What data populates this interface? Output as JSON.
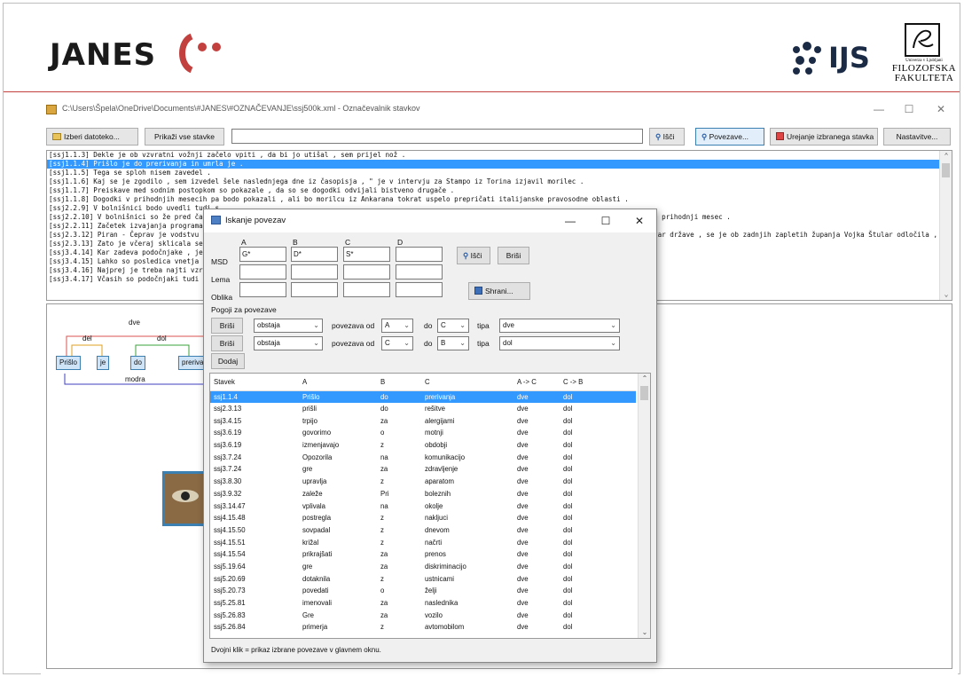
{
  "header": {
    "janes_label": "JANES",
    "ijs_label": "IJS",
    "ff_small": "Univerza v Ljubljani",
    "ff_line1": "FILOZOFSKA",
    "ff_line2": "FAKULTETA",
    "brand_color": "#c2413f"
  },
  "window": {
    "title": "C:\\Users\\Špela\\OneDrive\\Documents\\#JANES\\#OZNAČEVANJE\\ssj500k.xml - Označevalnik stavkov",
    "minimize": "—",
    "maximize": "☐",
    "close": "✕"
  },
  "toolbar": {
    "choose_file": "Izberi datoteko...",
    "show_all": "Prikaži vse stavke",
    "search_value": "",
    "search_btn": "Išči",
    "links_btn": "Povezave...",
    "edit_btn": "Urejanje izbranega stavka",
    "settings_btn": "Nastavitve..."
  },
  "sentences": [
    {
      "text": "[ssj1.1.3] Dekle je ob vzvratni vožnji začelo vpiti , da bi jo utišal , sem prijel nož .",
      "selected": false
    },
    {
      "text": "[ssj1.1.4] Prišlo je do prerivanja in umrla je .",
      "selected": true
    },
    {
      "text": "[ssj1.1.5] Tega se sploh nisem zavedel .",
      "selected": false
    },
    {
      "text": "[ssj1.1.6] Kaj se je zgodilo , sem izvedel šele naslednjega dne iz časopisja , \" je v intervju za Stampo iz Torina izjavil morilec .",
      "selected": false
    },
    {
      "text": "[ssj1.1.7] Preiskave med sodnim postopkom so pokazale , da so se dogodki odvijali bistveno drugače .",
      "selected": false
    },
    {
      "text": "[ssj1.1.8] Dogodki v prihodnjih mesecih pa bodo pokazali , ali bo morilcu iz Ankarana tokrat uspelo prepričati italijanske pravosodne oblasti .",
      "selected": false
    },
    {
      "text": "[ssj2.2.9] V bolnišnici bodo uvedli tudi s",
      "selected": false
    },
    {
      "text": "[ssj2.2.10] V bolnišnici so že pred časom",
      "selected": false,
      "tail": "o prihodnji mesec ."
    },
    {
      "text": "[ssj2.2.11] Začetek izvajanja programa je",
      "selected": false
    },
    {
      "text": "[ssj2.3.12] Piran - Čeprav je vodstvu pira",
      "selected": false,
      "tail": "var države , se je ob zadnjih zapletih županja Vojka Štular odločila , da jim"
    },
    {
      "text": "[ssj2.3.13] Zato je včeraj sklicala sestanel",
      "selected": false
    },
    {
      "text": "[ssj3.4.14] Kar zadeva podočnjake , je st",
      "selected": false
    },
    {
      "text": "[ssj3.4.15] Lahko so posledica vnetja vek",
      "selected": false
    },
    {
      "text": "[ssj3.4.16] Najprej je treba najti vzrok , z",
      "selected": false
    },
    {
      "text": "[ssj3.4.17] Včasih so podočnjaki tudi posle",
      "selected": false
    }
  ],
  "graph": {
    "arcs": {
      "dve": "dve",
      "del": "del",
      "dol": "dol",
      "modra": "modra"
    },
    "nodes": [
      "Prišlo",
      "je",
      "do",
      "prerivanj"
    ]
  },
  "dialog": {
    "title": "Iskanje povezav",
    "minimize": "—",
    "maximize": "☐",
    "close": "✕",
    "col_headers": [
      "A",
      "B",
      "C",
      "D"
    ],
    "row_labels": {
      "msd": "MSD",
      "lema": "Lema",
      "oblika": "Oblika"
    },
    "msd_values": [
      "G*",
      "D*",
      "S*",
      ""
    ],
    "search_btn": "Išči",
    "delete_btn": "Briši",
    "save_btn": "Shrani...",
    "conditions_label": "Pogoji za povezave",
    "conditions": [
      {
        "delete": "Briši",
        "mode": "obstaja",
        "from_label": "povezava od",
        "from": "A",
        "to_label": "do",
        "to": "C",
        "type_label": "tipa",
        "type": "dve"
      },
      {
        "delete": "Briši",
        "mode": "obstaja",
        "from_label": "povezava od",
        "from": "C",
        "to_label": "do",
        "to": "B",
        "type_label": "tipa",
        "type": "dol"
      }
    ],
    "add_btn": "Dodaj",
    "table": {
      "headers": [
        "Stavek",
        "A",
        "B",
        "C",
        "A -> C",
        "C -> B"
      ],
      "rows": [
        [
          "ssj1.1.4",
          "Prišlo",
          "do",
          "prerivanja",
          "dve",
          "dol"
        ],
        [
          "ssj2.3.13",
          "prišli",
          "do",
          "rešitve",
          "dve",
          "dol"
        ],
        [
          "ssj3.4.15",
          "trpijo",
          "za",
          "alergijami",
          "dve",
          "dol"
        ],
        [
          "ssj3.6.19",
          "govorimo",
          "o",
          "motnji",
          "dve",
          "dol"
        ],
        [
          "ssj3.6.19",
          "izmenjavajo",
          "z",
          "obdobji",
          "dve",
          "dol"
        ],
        [
          "ssj3.7.24",
          "Opozorila",
          "na",
          "komunikacijo",
          "dve",
          "dol"
        ],
        [
          "ssj3.7.24",
          "gre",
          "za",
          "zdravljenje",
          "dve",
          "dol"
        ],
        [
          "ssj3.8.30",
          "upravlja",
          "z",
          "aparatom",
          "dve",
          "dol"
        ],
        [
          "ssj3.9.32",
          "zaleže",
          "Pri",
          "boleznih",
          "dve",
          "dol"
        ],
        [
          "ssj3.14.47",
          "vplivala",
          "na",
          "okolje",
          "dve",
          "dol"
        ],
        [
          "ssj4.15.48",
          "postregla",
          "z",
          "nakljuci",
          "dve",
          "dol"
        ],
        [
          "ssj4.15.50",
          "sovpadal",
          "z",
          "dnevom",
          "dve",
          "dol"
        ],
        [
          "ssj4.15.51",
          "križal",
          "z",
          "načrti",
          "dve",
          "dol"
        ],
        [
          "ssj4.15.54",
          "prikrajšati",
          "za",
          "prenos",
          "dve",
          "dol"
        ],
        [
          "ssj5.19.64",
          "gre",
          "za",
          "diskriminacijo",
          "dve",
          "dol"
        ],
        [
          "ssj5.20.69",
          "dotaknila",
          "z",
          "ustnicami",
          "dve",
          "dol"
        ],
        [
          "ssj5.20.73",
          "povedati",
          "o",
          "želji",
          "dve",
          "dol"
        ],
        [
          "ssj5.25.81",
          "imenovali",
          "za",
          "naslednika",
          "dve",
          "dol"
        ],
        [
          "ssj5.26.83",
          "Gre",
          "za",
          "vozilo",
          "dve",
          "dol"
        ],
        [
          "ssj5.26.84",
          "primerja",
          "z",
          "avtomobilom",
          "dve",
          "dol"
        ]
      ]
    },
    "status": "Dvojni klik = prikaz izbrane povezave v glavnem oknu."
  }
}
